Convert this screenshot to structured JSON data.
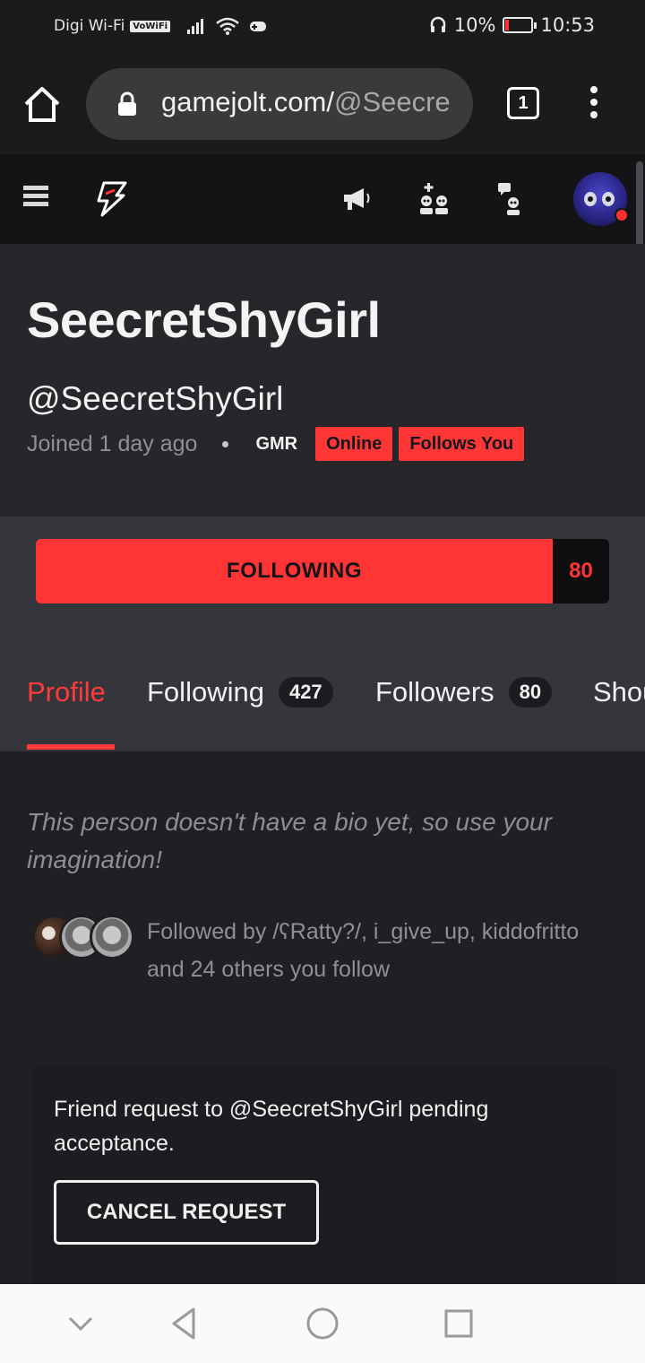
{
  "status_bar": {
    "carrier": "Digi Wi-Fi",
    "vowifi": "VoWiFi",
    "battery_percent": "10%",
    "time": "10:53",
    "battery_level": 0.1
  },
  "browser": {
    "url_host": "gamejolt.com/",
    "url_path": "@Seecre",
    "tab_count": "1"
  },
  "profile": {
    "display_name": "SeecretShyGirl",
    "username": "@SeecretShyGirl",
    "joined": "Joined 1 day ago",
    "rank": "GMR",
    "tags": [
      "Online",
      "Follows You"
    ]
  },
  "follow": {
    "button_label": "FOLLOWING",
    "count": "80"
  },
  "tabs": [
    {
      "label": "Profile",
      "badge": null,
      "active": true
    },
    {
      "label": "Following",
      "badge": "427",
      "active": false
    },
    {
      "label": "Followers",
      "badge": "80",
      "active": false
    },
    {
      "label": "Shou",
      "badge": null,
      "active": false
    }
  ],
  "bio": "This person doesn't have a bio yet, so use your imagination!",
  "followed_by": "Followed by /ʕRatty?/, i_give_up, kiddofritto and 24 others you follow",
  "friend_request": {
    "text": "Friend request to @SeecretShyGirl pending acceptance.",
    "cancel_label": "CANCEL REQUEST"
  },
  "colors": {
    "accent": "#ff3434",
    "background": "#1f1f24",
    "header": "#26262b"
  }
}
